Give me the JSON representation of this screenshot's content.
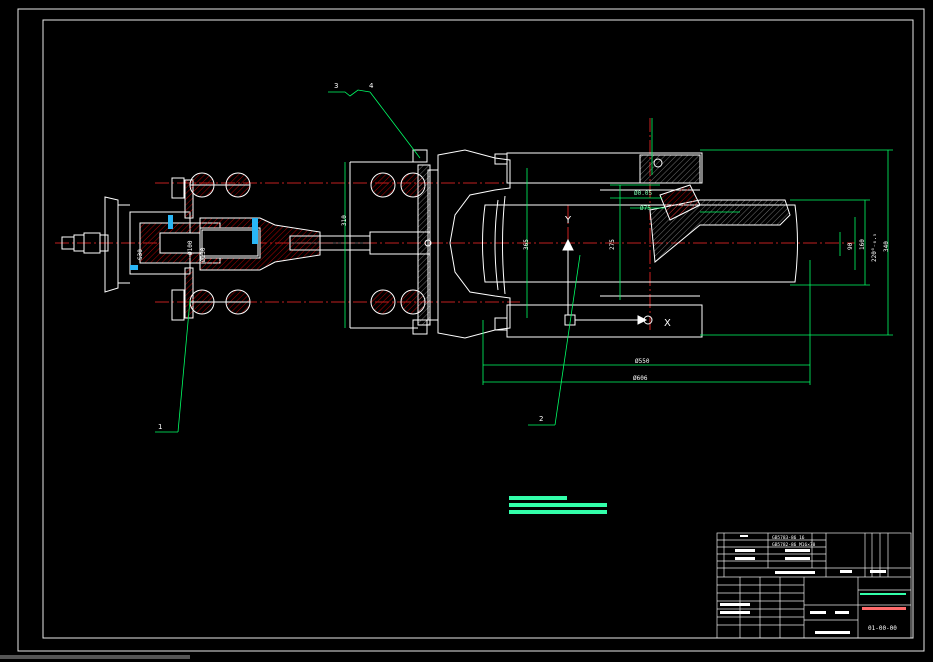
{
  "callouts": {
    "c1": "1",
    "c2": "2",
    "c3": "3",
    "c4": "4"
  },
  "dimensions": {
    "d_left_310": "310",
    "d_phi100": "Ø100",
    "d_phi130": "Ø130",
    "d_s30": "S30",
    "d_365": "365",
    "d_275": "275",
    "d_90": "90",
    "d_160": "160",
    "d_220": "220⁰₋₀.₅",
    "d_340": "340",
    "d_phi550": "Ø550",
    "d_phi606": "Ø606",
    "d_ang": "Ø0.05",
    "d_phi75": "Ø75"
  },
  "view_marks": {
    "y": "Y",
    "x": "X"
  },
  "parts_table": {
    "row4": "GB5783-86 16",
    "row3": "GB5782-86 M16×70"
  },
  "title_block": {
    "drawing_number": "01-00-00"
  },
  "colors": {
    "frame": "#00ff66",
    "lines": "#ffffff",
    "center": "#ff2a2a",
    "dim": "#00ff66",
    "accent": "#33ffaa",
    "cyan": "#29b6f6"
  }
}
